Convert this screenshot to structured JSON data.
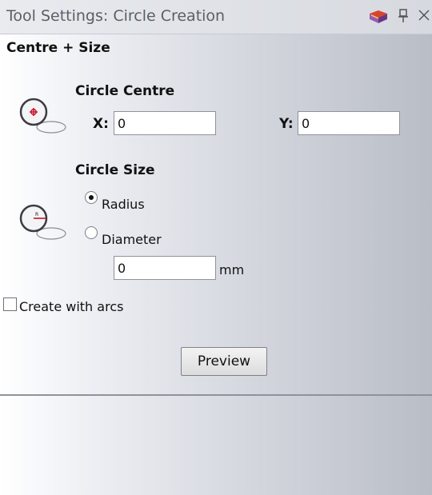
{
  "window": {
    "title": "Tool Settings: Circle Creation",
    "icons": [
      "book-icon",
      "pin-icon",
      "close-icon"
    ]
  },
  "section": {
    "title": "Centre + Size"
  },
  "centre": {
    "title": "Circle Centre",
    "x_label": "X:",
    "x_value": "0",
    "y_label": "Y:",
    "y_value": "0"
  },
  "size": {
    "title": "Circle Size",
    "radius_label": "Radius",
    "radius_selected": true,
    "diameter_label": "Diameter",
    "diameter_selected": false,
    "value": "0",
    "unit": "mm"
  },
  "options": {
    "create_with_arcs_label": "Create with arcs",
    "create_with_arcs_checked": false
  },
  "actions": {
    "preview_label": "Preview"
  },
  "colors": {
    "accent_red": "#c8102e"
  }
}
